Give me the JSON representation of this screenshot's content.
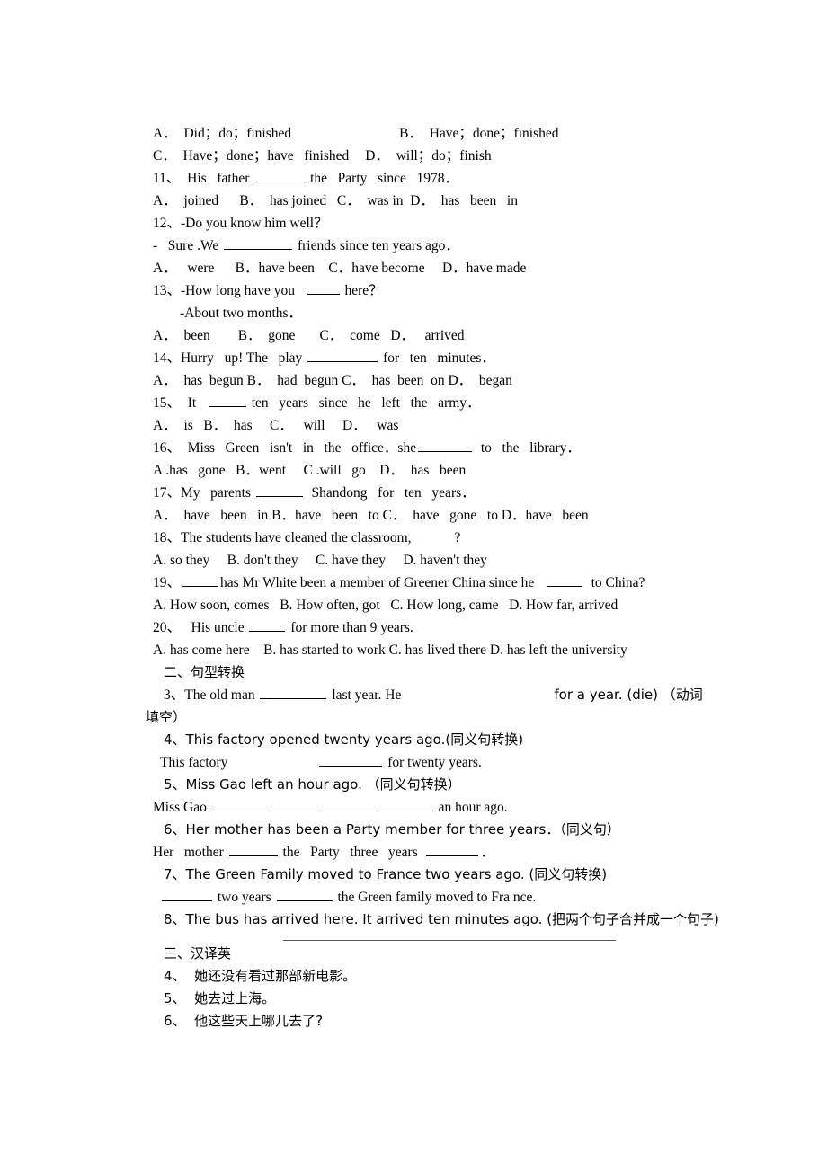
{
  "document": {
    "type": "english-grammar-worksheet",
    "language_mix": "english-chinese",
    "background_color": "#ffffff",
    "text_color": "#000000"
  },
  "multiple_choice": {
    "q10_options_line1": "A．  Did；do；finished",
    "q10_options_line1_b": "B．  Have；done；finished",
    "q10_options_line2": "C．  Have；done；have   finished",
    "q10_options_line2_d": "D．  will；do；finish",
    "q11_stem_a": "11、  His   father  ",
    "q11_stem_b": " the   Party   since   1978．",
    "q11_options": "A．  joined      B．  has joined   C．  was in  D．  has   been   in",
    "q12_stem": "12、-Do you know him well？",
    "q12_answer_a": "-   Sure .We ",
    "q12_answer_b": " friends since ten years ago．",
    "q12_options": "A．   were      B．have been    C．have become     D．have made",
    "q13_stem_a": "13、-How long have you   ",
    "q13_stem_b": " here？",
    "q13_reply": "-About two months．",
    "q13_options": "A．  been        B．  gone       C．  come   D．   arrived",
    "q14_stem_a": "14、Hurry   up! The   play ",
    "q14_stem_b": " for   ten   minutes．",
    "q14_options": "A．  has  begun B．  had  begun C．  has  been  on D．  began",
    "q15_stem_a": "15、  It   ",
    "q15_stem_b": " ten   years   since   he   left   the   army．",
    "q15_options": "A．  is   B．  has     C．   will     D．   was",
    "q16_stem_a": "16、  Miss   Green   isn't   in   the   office．she",
    "q16_stem_b": "  to   the   library．",
    "q16_options": "A .has   gone   B．went     C .will   go    D．  has   been",
    "q17_stem_a": "17、My   parents ",
    "q17_stem_b": "  Shandong   for   ten   years．",
    "q17_options": "A．  have   been   in B．have   been   to C．  have   gone   to D．have   been",
    "q18_stem_a": "18、The students have cleaned the classroom,",
    "q18_stem_b": "?",
    "q18_options": "A. so they     B. don't they     C. have they     D. haven't they",
    "q19_stem_a": "19、",
    "q19_stem_b": "has Mr White been a member of Greener China since he   ",
    "q19_stem_c": "  to China?",
    "q19_options": "A. How soon, comes   B. How often, got   C. How long, came   D. How far, arrived",
    "q20_stem_a": "20、   His uncle ",
    "q20_stem_b": " for more than 9 years.",
    "q20_options": "A. has come here    B. has started to work C. has lived there D. has left the university"
  },
  "section2": {
    "heading": "二、句型转换",
    "q3_a": "3、The old man ",
    "q3_b": " last year. He",
    "q3_c": "for a year. (die) （动词",
    "q3_d": "填空）",
    "q4_stem": "4、This factory opened twenty years ago.(同义句转换)",
    "q4_answer_a": "This factory",
    "q4_answer_b": " for twenty years.",
    "q5_stem": "5、Miss Gao left an hour ago. （同义句转换）",
    "q5_answer_a": "Miss Gao ",
    "q5_answer_b": " an hour ago.",
    "q6_stem": "6、Her mother has been a Party member for three years．（同义句）",
    "q6_answer_a": "Her   mother ",
    "q6_answer_b": " the   Party   three   years  ",
    "q6_answer_c": "．",
    "q7_stem": "7、The Green Family moved to France two years ago. (同义句转换)",
    "q7_answer_a": " two years ",
    "q7_answer_b": " the Green family moved to Fra nce.",
    "q8_stem": "8、The bus has arrived here. It arrived ten minutes ago. (把两个句子合并成一个句子)"
  },
  "section3": {
    "heading": "三、汉译英",
    "items": [
      "4、  她还没有看过那部新电影。",
      "5、  她去过上海。",
      "6、  他这些天上哪儿去了?"
    ]
  }
}
